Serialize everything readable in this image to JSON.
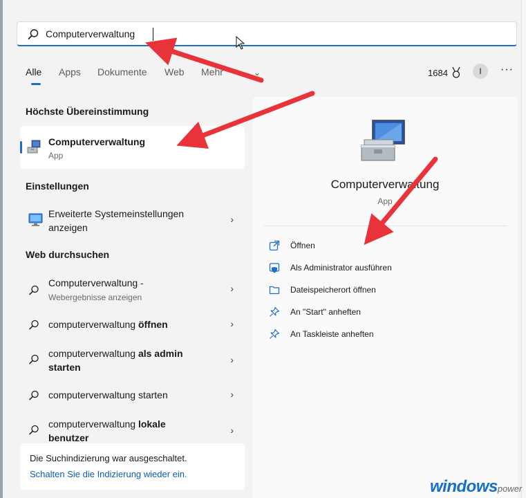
{
  "search": {
    "value": "Computerverwaltung"
  },
  "tabs": [
    {
      "label": "Alle"
    },
    {
      "label": "Apps"
    },
    {
      "label": "Dokumente"
    },
    {
      "label": "Web"
    },
    {
      "label": "Mehr"
    }
  ],
  "header": {
    "points": "1684",
    "avatar_initial": "I"
  },
  "left": {
    "best_match_title": "Höchste Übereinstimmung",
    "best_match": {
      "name": "Computerverwaltung",
      "type": "App"
    },
    "settings_title": "Einstellungen",
    "settings_items": [
      {
        "line1": "Erweiterte Systemeinstellungen",
        "line2": "anzeigen"
      }
    ],
    "web_title": "Web durchsuchen",
    "web_items": [
      {
        "normal": "Computerverwaltung -",
        "bold": "",
        "sub": "Webergebnisse anzeigen"
      },
      {
        "normal": "computerverwaltung ",
        "bold": "öffnen",
        "sub": ""
      },
      {
        "normal": "computerverwaltung ",
        "bold": "als admin",
        "line2_bold": "starten",
        "sub": ""
      },
      {
        "normal": "computerverwaltung starten",
        "bold": "",
        "sub": ""
      },
      {
        "normal": "computerverwaltung ",
        "bold": "lokale",
        "line2_bold": "benutzer",
        "sub": ""
      }
    ],
    "index_message": "Die Suchindizierung war ausgeschaltet.",
    "index_link": "Schalten Sie die Indizierung wieder ein."
  },
  "right": {
    "app_name": "Computerverwaltung",
    "app_type": "App",
    "actions": [
      {
        "label": "Öffnen",
        "icon": "open-external-icon"
      },
      {
        "label": "Als Administrator ausführen",
        "icon": "shield-admin-icon"
      },
      {
        "label": "Dateispeicherort öffnen",
        "icon": "folder-icon"
      },
      {
        "label": "An \"Start\" anheften",
        "icon": "pin-icon"
      },
      {
        "label": "An Taskleiste anheften",
        "icon": "pin-icon"
      }
    ]
  },
  "watermark": {
    "brand": "windows",
    "suffix": "power"
  },
  "colors": {
    "accent": "#1f6fc5",
    "link": "#0a5cb8",
    "annotation_arrow": "#e8333a"
  }
}
